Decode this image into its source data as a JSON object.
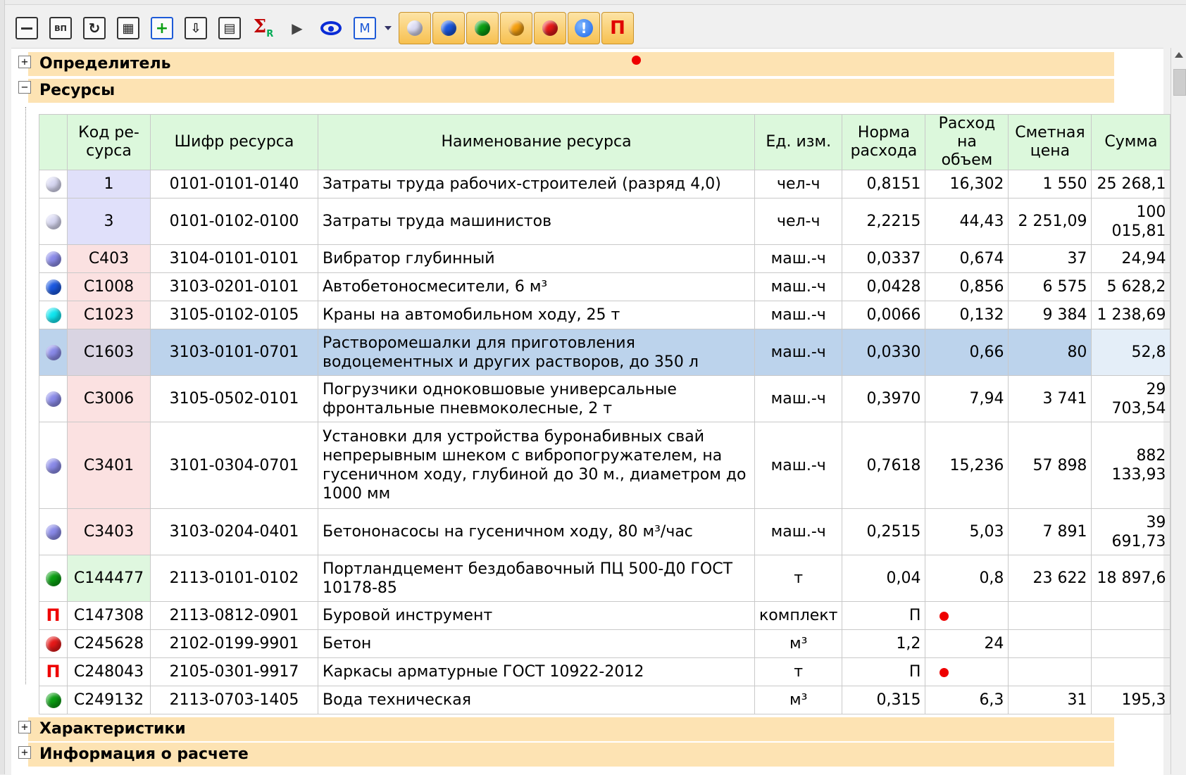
{
  "toolbar": {
    "buttons": [
      {
        "name": "collapse",
        "glyph": "—"
      },
      {
        "name": "vp",
        "glyph": "ВП"
      },
      {
        "name": "refresh",
        "glyph": "↻"
      },
      {
        "name": "calc",
        "glyph": "▦"
      },
      {
        "name": "add",
        "glyph": "+"
      },
      {
        "name": "insert",
        "glyph": "⬇"
      },
      {
        "name": "doc",
        "glyph": "▤"
      },
      {
        "name": "sum",
        "glyph": "Σ"
      },
      {
        "name": "share",
        "glyph": "▶"
      },
      {
        "name": "view",
        "glyph": ""
      },
      {
        "name": "m",
        "glyph": "M"
      }
    ],
    "sigma_label": "Σ",
    "sigma_sub": "R",
    "m_label": "M",
    "vp_label": "ВП",
    "filters": [
      {
        "name": "all",
        "color": "#dcdcf4"
      },
      {
        "name": "blue",
        "color": "#1a58e0"
      },
      {
        "name": "green",
        "color": "#0a9e12"
      },
      {
        "name": "orange",
        "color": "#f5a010"
      },
      {
        "name": "red",
        "color": "#e61818"
      },
      {
        "name": "info",
        "color": "#1a63e8"
      },
      {
        "name": "p",
        "color": "#e00000"
      }
    ],
    "info_label": "!",
    "p_label": "П"
  },
  "sections": {
    "opredelitel": "Определитель",
    "resursy": "Ресурсы",
    "harakteristiki": "Характеристики",
    "info": "Информация о расчете"
  },
  "table": {
    "headers": {
      "kod": "Код ре-сурса",
      "shifr": "Шифр ресурса",
      "name": "Наименование ресурса",
      "ed": "Ед. изм.",
      "norma": "Норма расхода",
      "rashod": "Расход на объем",
      "cena": "Сметная цена",
      "summa": "Сумма"
    },
    "rows": [
      {
        "icon": "lav",
        "kod": "1",
        "shifr": "0101-0101-0140",
        "name": "Затраты труда рабочих-строителей (разряд 4,0)",
        "ed": "чел-ч",
        "norma": "0,8151",
        "rashod": "16,302",
        "cena": "1 550",
        "summa": "25 268,1"
      },
      {
        "icon": "lav",
        "kod": "3",
        "shifr": "0101-0102-0100",
        "name": "Затраты труда машинистов",
        "ed": "чел-ч",
        "norma": "2,2215",
        "rashod": "44,43",
        "cena": "2 251,09",
        "summa": "100 015,81"
      },
      {
        "icon": "per",
        "kod": "С403",
        "shifr": "3104-0101-0101",
        "name": "Вибратор глубинный",
        "ed": "маш.-ч",
        "norma": "0,0337",
        "rashod": "0,674",
        "cena": "37",
        "summa": "24,94"
      },
      {
        "icon": "blue",
        "kod": "С1008",
        "shifr": "3103-0201-0101",
        "name": "Автобетоносмесители, 6 м³",
        "ed": "маш.-ч",
        "norma": "0,0428",
        "rashod": "0,856",
        "cena": "6 575",
        "summa": "5 628,2"
      },
      {
        "icon": "cyan",
        "kod": "С1023",
        "shifr": "3105-0102-0105",
        "name": "Краны на автомобильном ходу, 25 т",
        "ed": "маш.-ч",
        "norma": "0,0066",
        "rashod": "0,132",
        "cena": "9 384",
        "summa": "1 238,69"
      },
      {
        "icon": "per",
        "kod": "С1603",
        "shifr": "3103-0101-0701",
        "name": "Растворомешалки для приготовления водоцементных и других растворов, до 350 л",
        "ed": "маш.-ч",
        "norma": "0,0330",
        "rashod": "0,66",
        "cena": "80",
        "summa": "52,8"
      },
      {
        "icon": "per",
        "kod": "С3006",
        "shifr": "3105-0502-0101",
        "name": "Погрузчики одноковшовые универсальные фронтальные пневмоколесные, 2 т",
        "ed": "маш.-ч",
        "norma": "0,3970",
        "rashod": "7,94",
        "cena": "3 741",
        "summa": "29 703,54"
      },
      {
        "icon": "per",
        "kod": "С3401",
        "shifr": "3101-0304-0701",
        "name": "Установки для устройства буронабивных свай непрерывным шнеком с вибропогружателем, на гусеничном ходу, глубиной до 30 м., диаметром до 1000 мм",
        "ed": "маш.-ч",
        "norma": "0,7618",
        "rashod": "15,236",
        "cena": "57 898",
        "summa": "882 133,93"
      },
      {
        "icon": "per",
        "kod": "С3403",
        "shifr": "3103-0204-0401",
        "name": "Бетононасосы на гусеничном ходу, 80 м³/час",
        "ed": "маш.-ч",
        "norma": "0,2515",
        "rashod": "5,03",
        "cena": "7 891",
        "summa": "39 691,73"
      },
      {
        "icon": "green",
        "kod": "С144477",
        "shifr": "2113-0101-0102",
        "name": "Портландцемент бездобавочный ПЦ 500-Д0 ГОСТ 10178-85",
        "ed": "т",
        "norma": "0,04",
        "rashod": "0,8",
        "cena": "23 622",
        "summa": "18 897,6"
      },
      {
        "icon": "p",
        "kod": "С147308",
        "shifr": "2113-0812-0901",
        "name": "Буровой инструмент",
        "ed": "комплект",
        "norma": "П",
        "rashod": "",
        "cena": "",
        "summa": ""
      },
      {
        "icon": "red",
        "kod": "С245628",
        "shifr": "2102-0199-9901",
        "name": "Бетон",
        "ed": "м³",
        "norma": "1,2",
        "rashod": "24",
        "cena": "",
        "summa": ""
      },
      {
        "icon": "p",
        "kod": "С248043",
        "shifr": "2105-0301-9917",
        "name": "Каркасы арматурные ГОСТ 10922-2012",
        "ed": "т",
        "norma": "П",
        "rashod": "",
        "cena": "",
        "summa": ""
      },
      {
        "icon": "green",
        "kod": "С249132",
        "shifr": "2113-0703-1405",
        "name": "Вода техническая",
        "ed": "м³",
        "norma": "0,315",
        "rashod": "6,3",
        "cena": "31",
        "summa": "195,3"
      }
    ]
  }
}
